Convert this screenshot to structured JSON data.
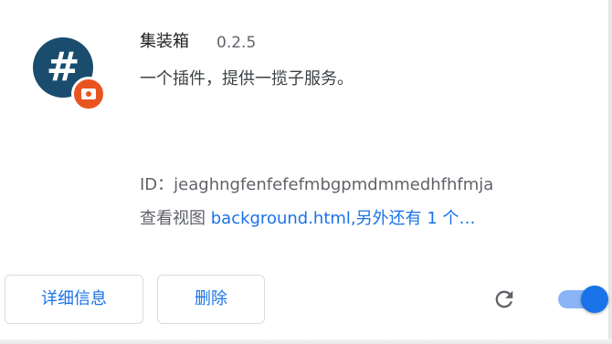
{
  "extension": {
    "name": "集装箱",
    "version": "0.2.5",
    "description": "一个插件，提供一揽子服务。",
    "id_label": "ID：",
    "id_value": "jeaghngfenfefefmbgpmdmmedhfhfmja",
    "views_label": "查看视图",
    "views_link": "background.html,另外还有 1 个…",
    "logo_text": "#",
    "enabled": true
  },
  "buttons": {
    "details_label": "详细信息",
    "remove_label": "删除"
  },
  "icons": {
    "logo": "hash-logo-icon",
    "badge": "camera-badge-icon",
    "reload": "reload-icon"
  },
  "colors": {
    "logo_bg": "#1a4d6d",
    "badge_bg": "#e8541f",
    "accent": "#1a73e8",
    "toggle_track": "#8ab4f8"
  }
}
